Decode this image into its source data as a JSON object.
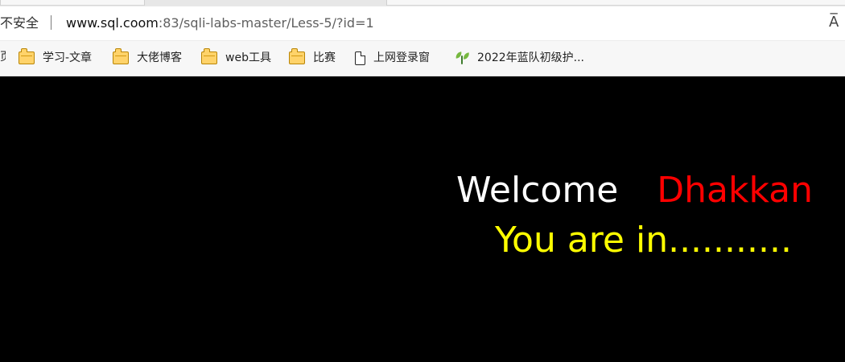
{
  "browser": {
    "security_label": "不安全",
    "url": {
      "domain": "www.sql.coom",
      "rest": ":83/sqli-labs-master/Less-5/?id=1"
    },
    "reader_icon": "A̅",
    "bookmarks": {
      "clipped_label": "页",
      "items": [
        {
          "label": "学习-文章",
          "icon": "folder-icon"
        },
        {
          "label": "大佬博客",
          "icon": "folder-icon"
        },
        {
          "label": "web工具",
          "icon": "folder-icon"
        },
        {
          "label": "比赛",
          "icon": "folder-icon"
        },
        {
          "label": "上网登录窗",
          "icon": "page-icon"
        },
        {
          "label": "2022年蓝队初级护...",
          "icon": "sprout-icon"
        }
      ]
    }
  },
  "page": {
    "welcome_text": "Welcome",
    "name_text": "Dhakkan",
    "status_text": "You are in..........."
  },
  "colors": {
    "page_background": "#000000",
    "welcome_text": "#ffffff",
    "name_text": "#ff0000",
    "status_text": "#ffff00",
    "folder_fill": "#ffd36a"
  }
}
